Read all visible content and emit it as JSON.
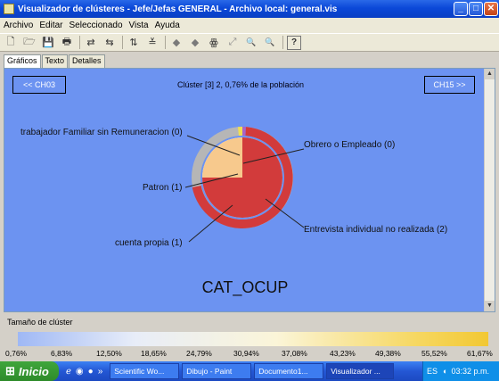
{
  "window": {
    "title": "Visualizador de clústeres - Jefe/Jefas GENERAL - Archivo local: general.vis",
    "buttons": {
      "minimize": "_",
      "maximize": "□",
      "close": "✕"
    }
  },
  "menu": [
    "Archivo",
    "Editar",
    "Seleccionado",
    "Vista",
    "Ayuda"
  ],
  "toolbar": {
    "icons": [
      "new-icon",
      "open-icon",
      "save-icon",
      "print-icon",
      "swap-icon",
      "swap-back-icon",
      "sort-icon",
      "filter-icon",
      "back-icon",
      "forward-icon",
      "binoculars-icon",
      "expand-icon",
      "zoom-in-icon",
      "zoom-out-icon",
      "help-icon"
    ],
    "glyphs": [
      "🗋",
      "🗁",
      "💾",
      "🖶",
      "⇄",
      "⇆",
      "⇅",
      "≚",
      "◆",
      "◆",
      "ꙮ",
      "⤢",
      "🔍",
      "🔍",
      "?"
    ]
  },
  "tabs": [
    "Gráficos",
    "Texto",
    "Detalles"
  ],
  "panel": {
    "prev_button": "<< CH03",
    "next_button": "CH15 >>",
    "header": "Clúster [3] 2, 0,76% de la población",
    "variable": "CAT_OCUP",
    "labels": {
      "familiar": "trabajador Familiar sin Remuneracion (0)",
      "obrero": "Obrero o Empleado (0)",
      "patron": "Patron (1)",
      "entrevista": "Entrevista individual no realizada (2)",
      "cuenta": "cuenta propia (1)"
    },
    "colors": {
      "background": "#6c93f1",
      "inner_red": "#d23b3b",
      "inner_tan": "#f7c98d",
      "outer_red": "#d23b3b",
      "outer_gray": "#b6b6b6",
      "outer_purple": "#a865c9",
      "outer_yellow": "#f0df52"
    }
  },
  "scale": {
    "title": "Tamaño de clúster",
    "ticks": [
      "0,76%",
      "6,83%",
      "12,50%",
      "18,65%",
      "24,79%",
      "30,94%",
      "37,08%",
      "43,23%",
      "49,38%",
      "55,52%",
      "61,67%"
    ]
  },
  "taskbar": {
    "start": "Inicio",
    "tasks": [
      "Scientific Wo...",
      "Dibujo - Paint",
      "Documento1...",
      "Visualizador ..."
    ],
    "lang": "ES",
    "time": "03:32 p.m."
  }
}
